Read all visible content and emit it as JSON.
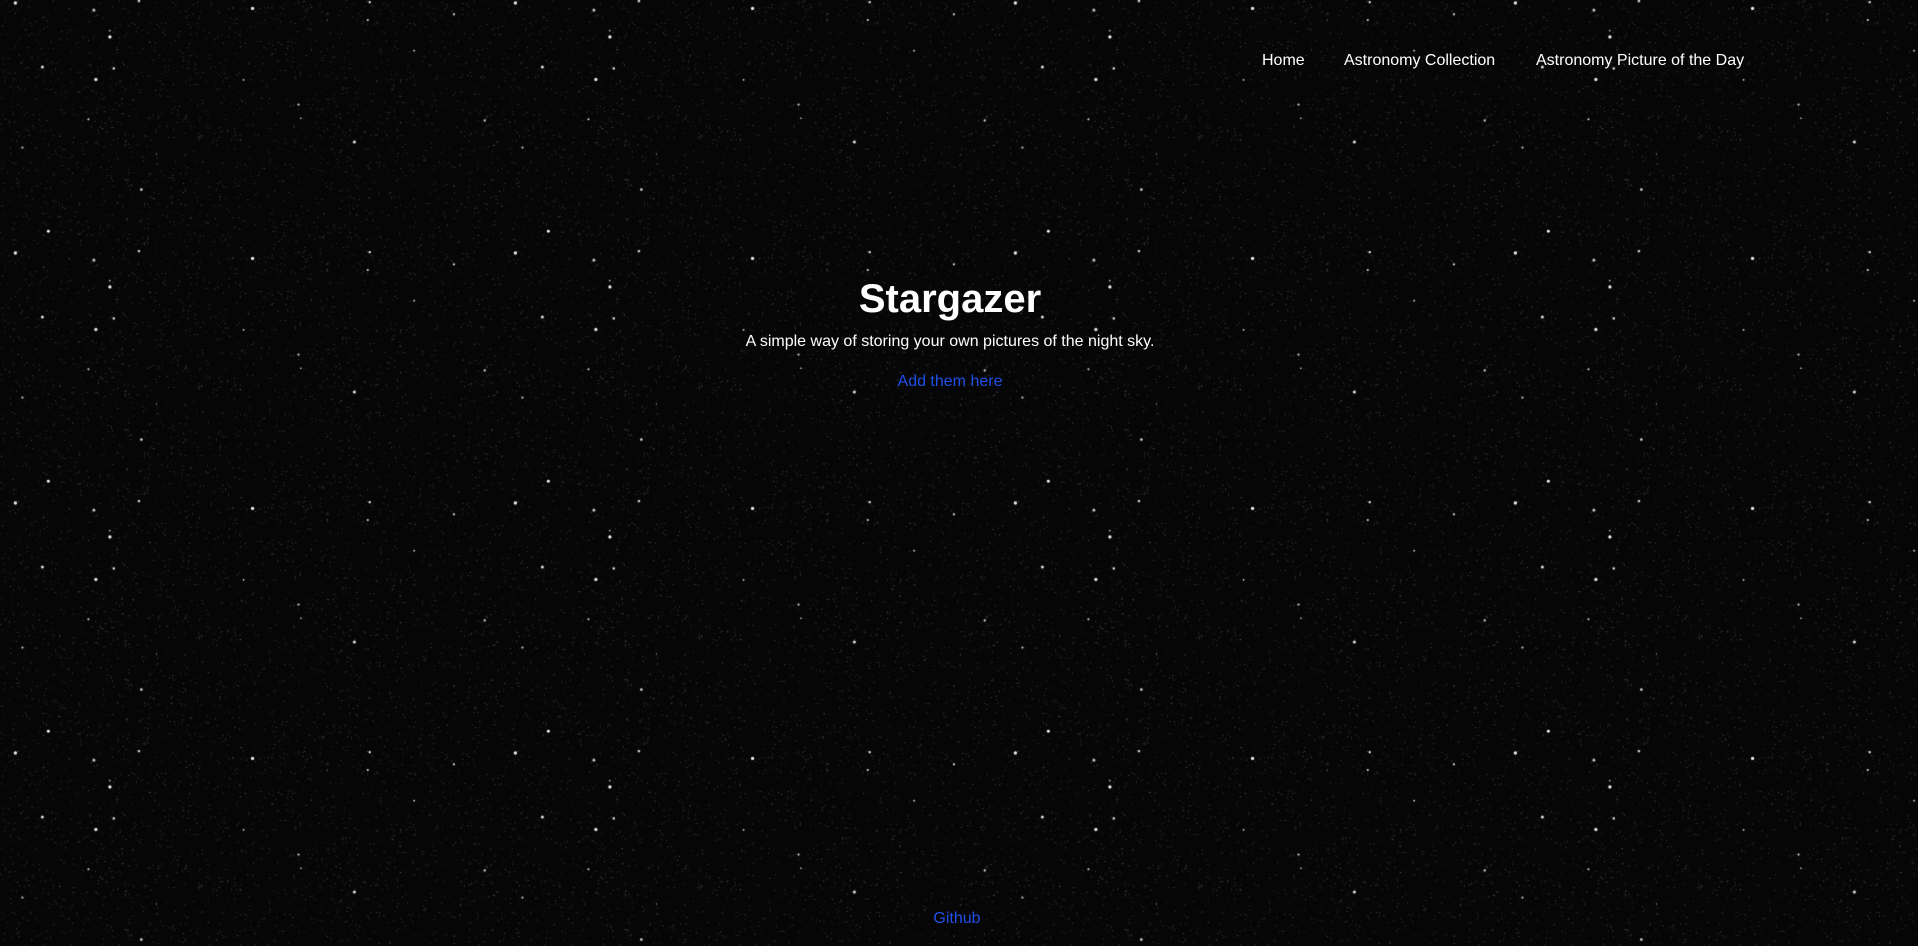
{
  "nav": {
    "items": [
      {
        "label": "Home"
      },
      {
        "label": "Astronomy Collection"
      },
      {
        "label": "Astronomy Picture of the Day"
      }
    ]
  },
  "hero": {
    "title": "Stargazer",
    "subtitle": "A simple way of storing your own pictures of the night sky.",
    "cta_label": "Add them here"
  },
  "footer": {
    "link_label": "Github"
  },
  "colors": {
    "background": "#060606",
    "text": "#ffffff",
    "link": "#1f4fe8"
  }
}
